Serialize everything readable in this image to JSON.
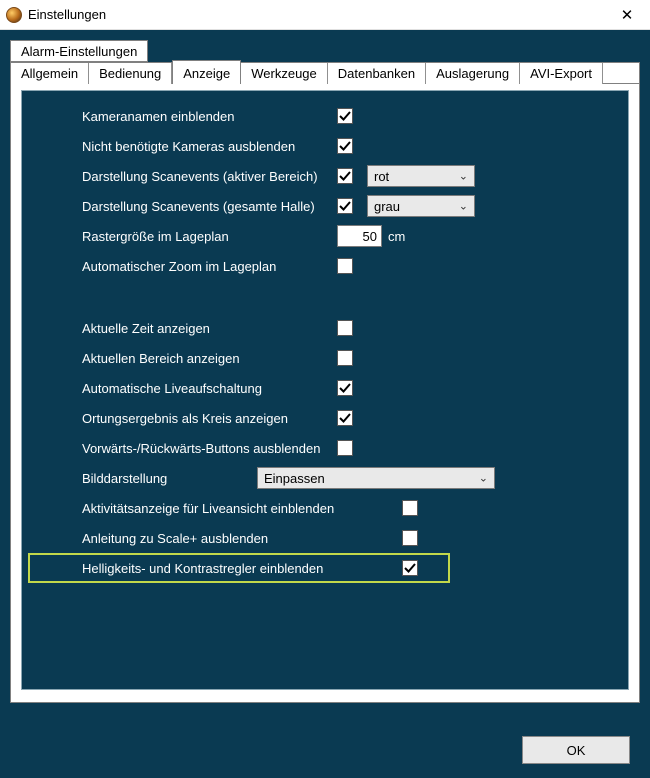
{
  "window": {
    "title": "Einstellungen",
    "close_glyph": "✕"
  },
  "tabstrip1": {
    "items": [
      {
        "label": "Alarm-Einstellungen"
      }
    ]
  },
  "tabstrip2": {
    "items": [
      {
        "label": "Allgemein"
      },
      {
        "label": "Bedienung"
      },
      {
        "label": "Anzeige",
        "active": true
      },
      {
        "label": "Werkzeuge"
      },
      {
        "label": "Datenbanken"
      },
      {
        "label": "Auslagerung"
      },
      {
        "label": "AVI-Export"
      }
    ]
  },
  "settings": {
    "r0": {
      "label": "Kameranamen einblenden",
      "checked": true
    },
    "r1": {
      "label": "Nicht benötigte Kameras ausblenden",
      "checked": true
    },
    "r2": {
      "label": "Darstellung Scanevents (aktiver Bereich)",
      "checked": true,
      "select": "rot"
    },
    "r3": {
      "label": "Darstellung Scanevents (gesamte Halle)",
      "checked": true,
      "select": "grau"
    },
    "r4": {
      "label": "Rastergröße im Lageplan",
      "value": "50",
      "unit": "cm"
    },
    "r5": {
      "label": "Automatischer Zoom im Lageplan",
      "checked": false
    },
    "r6": {
      "label": "Aktuelle Zeit anzeigen",
      "checked": false
    },
    "r7": {
      "label": "Aktuellen Bereich anzeigen",
      "checked": false
    },
    "r8": {
      "label": "Automatische Liveaufschaltung",
      "checked": true
    },
    "r9": {
      "label": "Ortungsergebnis als Kreis anzeigen",
      "checked": true
    },
    "r10": {
      "label": "Vorwärts-/Rückwärts-Buttons ausblenden",
      "checked": false
    },
    "r11": {
      "label": "Bilddarstellung",
      "select": "Einpassen"
    },
    "r12": {
      "label": "Aktivitätsanzeige für Liveansicht einblenden",
      "checked": false
    },
    "r13": {
      "label": "Anleitung zu Scale+ ausblenden",
      "checked": false
    },
    "r14": {
      "label": "Helligkeits- und Kontrastregler einblenden",
      "checked": true
    }
  },
  "buttons": {
    "ok": "OK"
  },
  "colors": {
    "bg_dark": "#0a3a52",
    "highlight_border": "#c2d84a"
  }
}
